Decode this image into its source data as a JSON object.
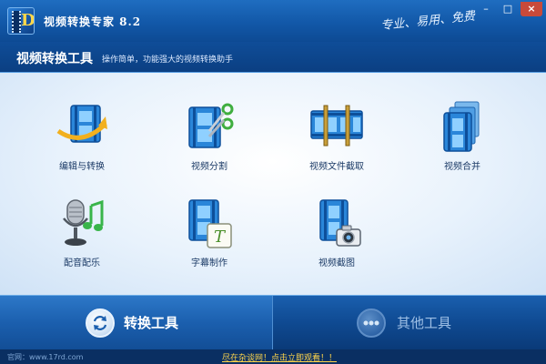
{
  "window": {
    "title": "视频转换专家 8.2",
    "slogan": "专业、易用、免费",
    "minimize_glyph": "–",
    "maximize_glyph": "□",
    "close_glyph": "×"
  },
  "section": {
    "title": "视频转换工具",
    "subtitle": "操作简单，功能强大的视频转换助手"
  },
  "tools": [
    {
      "label": "编辑与转换",
      "icon": "film-arrow-icon"
    },
    {
      "label": "视频分割",
      "icon": "film-scissors-icon"
    },
    {
      "label": "视频文件截取",
      "icon": "film-strip-clip-icon"
    },
    {
      "label": "视频合并",
      "icon": "film-stack-icon"
    },
    {
      "label": "配音配乐",
      "icon": "microphone-music-icon"
    },
    {
      "label": "字幕制作",
      "icon": "film-subtitle-icon"
    },
    {
      "label": "视频截图",
      "icon": "film-camera-icon"
    }
  ],
  "bottom_tabs": {
    "convert_label": "转换工具",
    "other_label": "其他工具"
  },
  "status": {
    "website": "官网：www.17rd.com",
    "promo": "尽在杂谈网！点击立即观看！！"
  },
  "colors": {
    "title_bar": "#1258a8",
    "panel_bg": "#e8f2fc",
    "accent_film": "#2a86d9",
    "promo_text": "#ffd54a"
  }
}
